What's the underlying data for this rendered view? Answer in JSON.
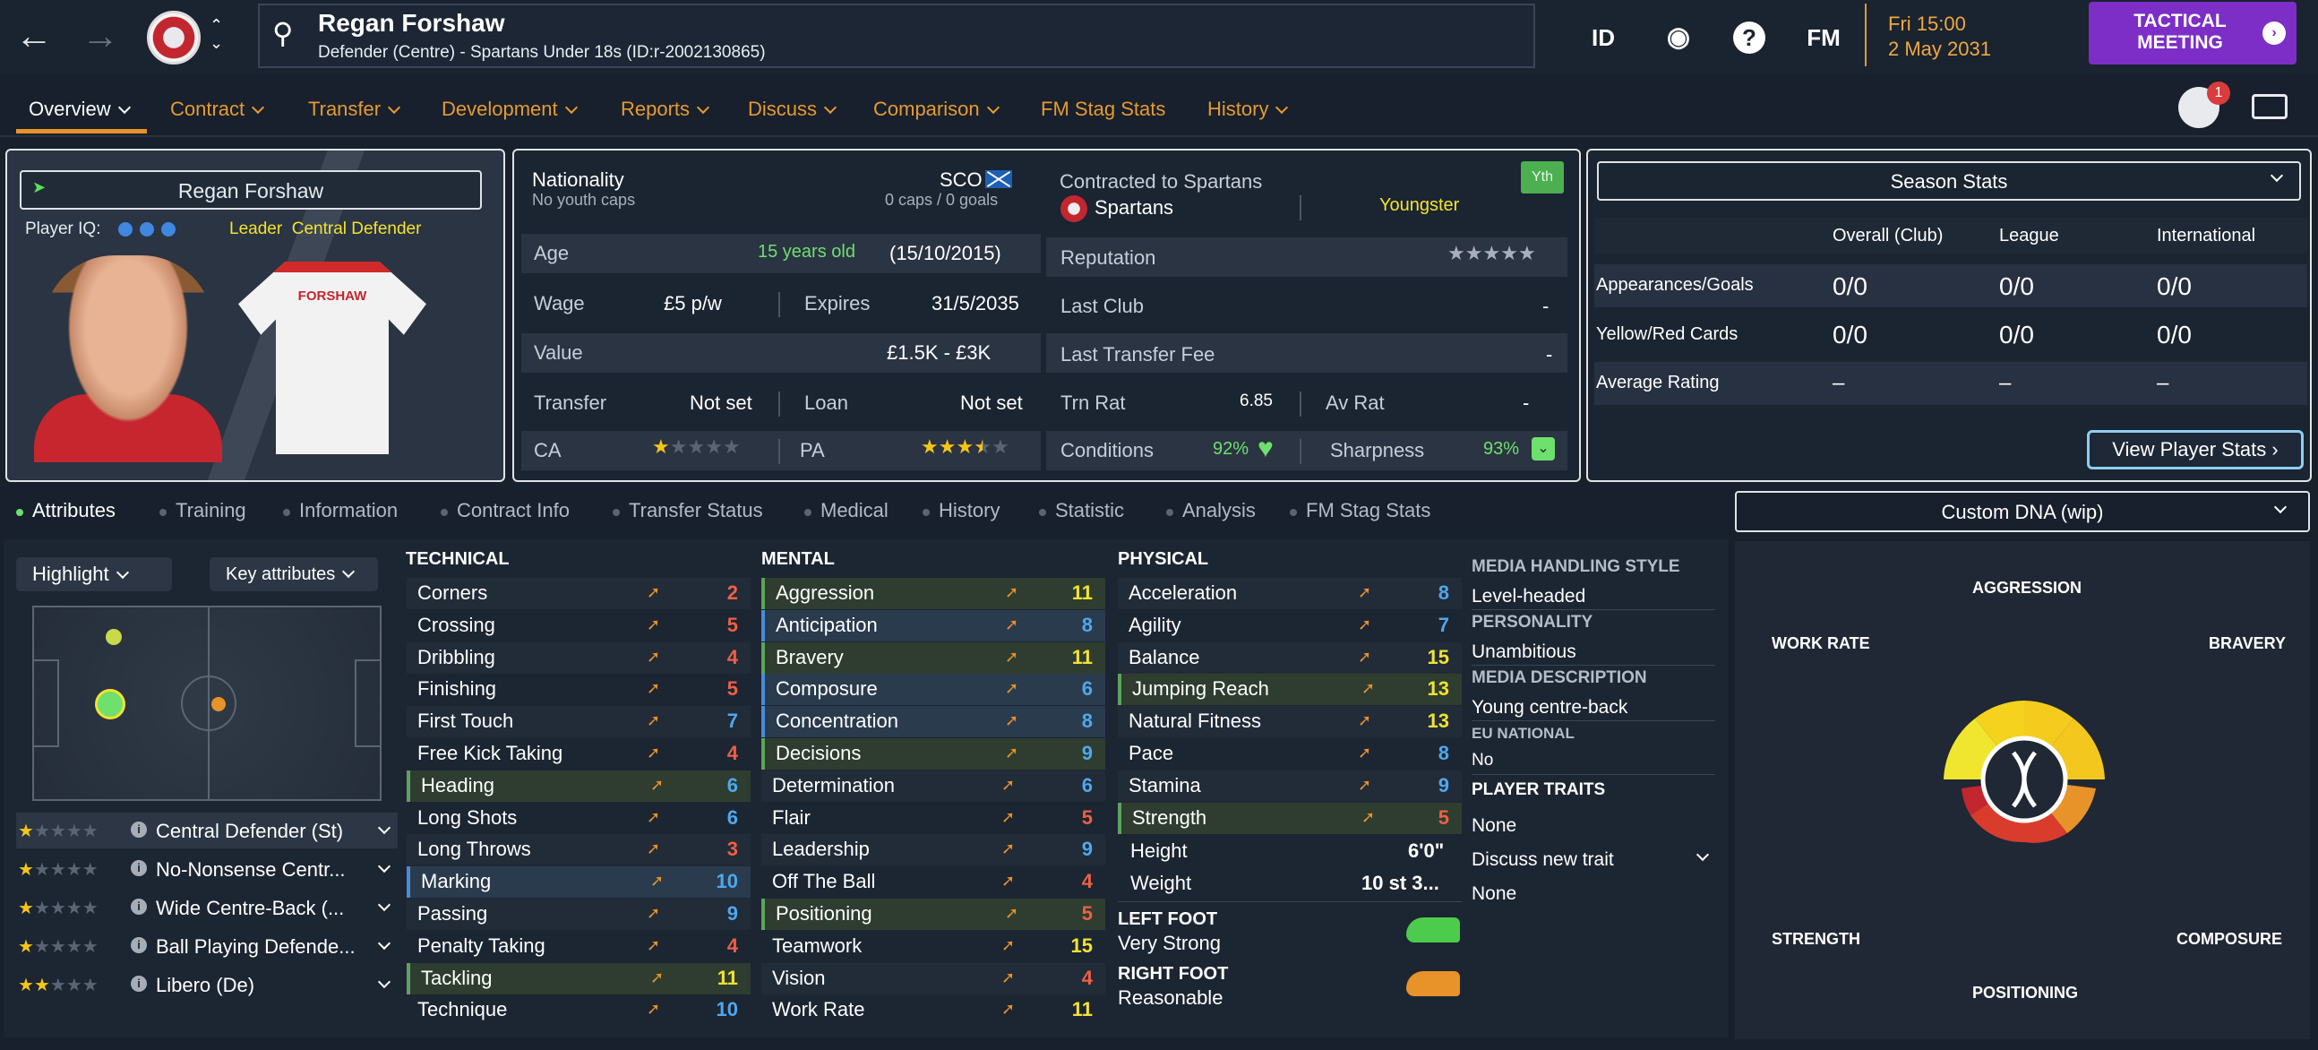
{
  "topbar": {
    "player_name": "Regan Forshaw",
    "player_sub": "Defender (Centre) - Spartans Under 18s (ID:r-2002130865)",
    "icons": [
      "back-arrow-icon",
      "forward-arrow-icon",
      "club-crest",
      "id-icon",
      "globe-icon",
      "help-icon",
      "fm-icon"
    ],
    "id_label": "ID",
    "fm_label": "FM",
    "date_line1": "Fri 15:00",
    "date_line2": "2 May 2031",
    "tactical_label": "TACTICAL MEETING",
    "notif_count": "1"
  },
  "menu": [
    "Overview",
    "Contract",
    "Transfer",
    "Development",
    "Reports",
    "Discuss",
    "Comparison",
    "FM Stag Stats",
    "History"
  ],
  "profile": {
    "name": "Regan Forshaw",
    "iq_label": "Player IQ:",
    "role_prefix": "Leader",
    "role": "Central Defender",
    "shirt_name": "FORSHAW"
  },
  "details": {
    "nationality_label": "Nationality",
    "nationality_code": "SCO",
    "youth_caps": "No youth caps",
    "caps": "0 caps / 0 goals",
    "age_label": "Age",
    "age": "15 years old",
    "dob": "(15/10/2015)",
    "wage_label": "Wage",
    "wage": "£5 p/w",
    "expires_label": "Expires",
    "expires": "31/5/2035",
    "value_label": "Value",
    "value": "£1.5K - £3K",
    "transfer_label": "Transfer",
    "transfer": "Not set",
    "loan_label": "Loan",
    "loan": "Not set",
    "ca_label": "CA",
    "pa_label": "PA",
    "ca_stars": 1,
    "pa_stars": 3.5,
    "contracted_label": "Contracted to Spartans",
    "club": "Spartans",
    "squad_status": "Youngster",
    "yth": "Yth",
    "reputation_label": "Reputation",
    "reputation_stars": 0,
    "last_club_label": "Last Club",
    "last_club": "-",
    "last_fee_label": "Last Transfer Fee",
    "last_fee": "-",
    "trn_rat_label": "Trn Rat",
    "trn_rat": "6.85",
    "av_rat_label": "Av Rat",
    "av_rat": "-",
    "conditions_label": "Conditions",
    "conditions": "92%",
    "sharpness_label": "Sharpness",
    "sharpness": "93%"
  },
  "season": {
    "dropdown": "Season Stats",
    "cols": [
      "Overall (Club)",
      "League",
      "International"
    ],
    "rows": [
      {
        "label": "Appearances/Goals",
        "values": [
          "0/0",
          "0/0",
          "0/0"
        ]
      },
      {
        "label": "Yellow/Red Cards",
        "values": [
          "0/0",
          "0/0",
          "0/0"
        ]
      },
      {
        "label": "Average Rating",
        "values": [
          "–",
          "–",
          "–"
        ]
      }
    ],
    "view_stats": "View Player Stats ›"
  },
  "tabs": [
    "Attributes",
    "Training",
    "Information",
    "Contract Info",
    "Transfer Status",
    "Medical",
    "History",
    "Statistic",
    "Analysis",
    "FM Stag Stats"
  ],
  "dna_dropdown": "Custom DNA (wip)",
  "controls": {
    "highlight": "Highlight",
    "key_attributes": "Key attributes"
  },
  "positions": [
    {
      "name": "Central Defender (St)",
      "stars": 1
    },
    {
      "name": "No-Nonsense Centr...",
      "stars": 1
    },
    {
      "name": "Wide Centre-Back (...",
      "stars": 1
    },
    {
      "name": "Ball Playing Defende...",
      "stars": 1
    },
    {
      "name": "Libero (De)",
      "stars": 2
    }
  ],
  "technical": {
    "title": "TECHNICAL",
    "items": [
      {
        "name": "Corners",
        "value": "2",
        "c": "red",
        "h": ""
      },
      {
        "name": "Crossing",
        "value": "5",
        "c": "red",
        "h": ""
      },
      {
        "name": "Dribbling",
        "value": "4",
        "c": "red",
        "h": ""
      },
      {
        "name": "Finishing",
        "value": "5",
        "c": "red",
        "h": ""
      },
      {
        "name": "First Touch",
        "value": "7",
        "c": "blue",
        "h": ""
      },
      {
        "name": "Free Kick Taking",
        "value": "4",
        "c": "red",
        "h": ""
      },
      {
        "name": "Heading",
        "value": "6",
        "c": "blue",
        "h": "g"
      },
      {
        "name": "Long Shots",
        "value": "6",
        "c": "blue",
        "h": ""
      },
      {
        "name": "Long Throws",
        "value": "3",
        "c": "red",
        "h": ""
      },
      {
        "name": "Marking",
        "value": "10",
        "c": "blue",
        "h": "b"
      },
      {
        "name": "Passing",
        "value": "9",
        "c": "blue",
        "h": ""
      },
      {
        "name": "Penalty Taking",
        "value": "4",
        "c": "red",
        "h": ""
      },
      {
        "name": "Tackling",
        "value": "11",
        "c": "yel",
        "h": "g"
      },
      {
        "name": "Technique",
        "value": "10",
        "c": "blue",
        "h": ""
      }
    ]
  },
  "mental": {
    "title": "MENTAL",
    "items": [
      {
        "name": "Aggression",
        "value": "11",
        "c": "yel",
        "h": "g"
      },
      {
        "name": "Anticipation",
        "value": "8",
        "c": "blue",
        "h": "b"
      },
      {
        "name": "Bravery",
        "value": "11",
        "c": "yel",
        "h": "g"
      },
      {
        "name": "Composure",
        "value": "6",
        "c": "blue",
        "h": "b"
      },
      {
        "name": "Concentration",
        "value": "8",
        "c": "blue",
        "h": "b"
      },
      {
        "name": "Decisions",
        "value": "9",
        "c": "blue",
        "h": "g"
      },
      {
        "name": "Determination",
        "value": "6",
        "c": "blue",
        "h": ""
      },
      {
        "name": "Flair",
        "value": "5",
        "c": "red",
        "h": ""
      },
      {
        "name": "Leadership",
        "value": "9",
        "c": "blue",
        "h": ""
      },
      {
        "name": "Off The Ball",
        "value": "4",
        "c": "red",
        "h": ""
      },
      {
        "name": "Positioning",
        "value": "5",
        "c": "red",
        "h": "g"
      },
      {
        "name": "Teamwork",
        "value": "15",
        "c": "yel",
        "h": ""
      },
      {
        "name": "Vision",
        "value": "4",
        "c": "red",
        "h": ""
      },
      {
        "name": "Work Rate",
        "value": "11",
        "c": "yel",
        "h": ""
      }
    ]
  },
  "physical": {
    "title": "PHYSICAL",
    "items": [
      {
        "name": "Acceleration",
        "value": "8",
        "c": "blue",
        "h": ""
      },
      {
        "name": "Agility",
        "value": "7",
        "c": "blue",
        "h": ""
      },
      {
        "name": "Balance",
        "value": "15",
        "c": "yel",
        "h": ""
      },
      {
        "name": "Jumping Reach",
        "value": "13",
        "c": "yel",
        "h": "g"
      },
      {
        "name": "Natural Fitness",
        "value": "13",
        "c": "yel",
        "h": ""
      },
      {
        "name": "Pace",
        "value": "8",
        "c": "blue",
        "h": ""
      },
      {
        "name": "Stamina",
        "value": "9",
        "c": "blue",
        "h": ""
      },
      {
        "name": "Strength",
        "value": "5",
        "c": "red",
        "h": "g"
      }
    ],
    "height_label": "Height",
    "height": "6'0\"",
    "weight_label": "Weight",
    "weight": "10 st 3...",
    "left_foot_label": "LEFT FOOT",
    "left_foot": "Very Strong",
    "right_foot_label": "RIGHT FOOT",
    "right_foot": "Reasonable"
  },
  "info": {
    "media_style_label": "MEDIA HANDLING STYLE",
    "media_style": "Level-headed",
    "personality_label": "PERSONALITY",
    "personality": "Unambitious",
    "media_desc_label": "MEDIA DESCRIPTION",
    "media_desc": "Young centre-back",
    "eu_label": "EU NATIONAL",
    "eu": "No",
    "traits_label": "PLAYER TRAITS",
    "traits": "None",
    "discuss": "Discuss new trait",
    "discuss_value": "None"
  },
  "dna": {
    "labels": [
      "AGGRESSION",
      "WORK RATE",
      "BRAVERY",
      "STRENGTH",
      "COMPOSURE",
      "POSITIONING"
    ]
  },
  "colors": {
    "accent": "#e8922a",
    "tactical": "#7c2ec7",
    "good": "#6ee06e",
    "star": "#f5c518"
  }
}
